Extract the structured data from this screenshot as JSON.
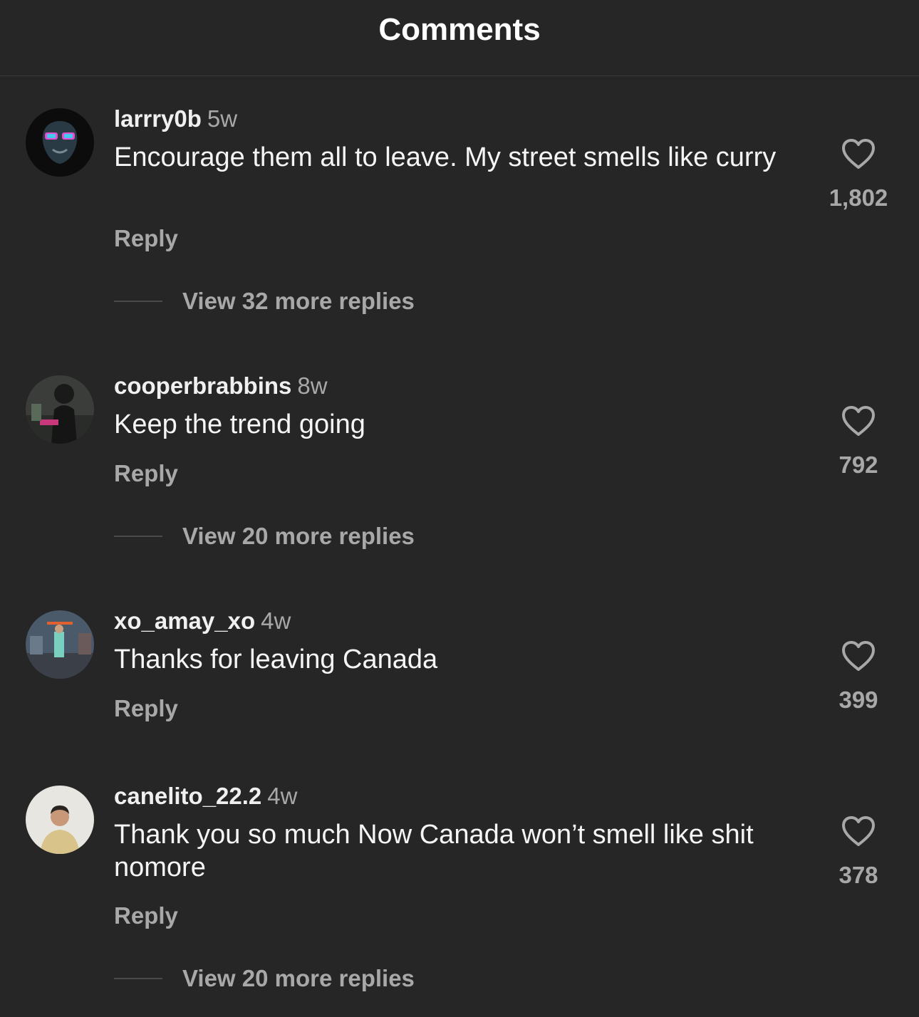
{
  "header": {
    "title": "Comments"
  },
  "comments": [
    {
      "username": "larrry0b",
      "time": "5w",
      "text": "Encourage them all to leave. My street smells like curry",
      "reply_label": "Reply",
      "likes": "1,802",
      "view_replies": "View 32 more replies"
    },
    {
      "username": "cooperbrabbins",
      "time": "8w",
      "text": "Keep the trend going",
      "reply_label": "Reply",
      "likes": "792",
      "view_replies": "View 20 more replies"
    },
    {
      "username": "xo_amay_xo",
      "time": "4w",
      "text": "Thanks for leaving Canada",
      "reply_label": "Reply",
      "likes": "399"
    },
    {
      "username": "canelito_22.2",
      "time": "4w",
      "text": "Thank you so much Now Canada won’t smell like shit nomore",
      "reply_label": "Reply",
      "likes": "378",
      "view_replies": "View 20 more replies"
    }
  ],
  "icons": {
    "like": "heart-outline-icon"
  },
  "colors": {
    "background": "#262626",
    "secondary_text": "#a8a8a8",
    "primary_text": "#f5f5f5"
  }
}
